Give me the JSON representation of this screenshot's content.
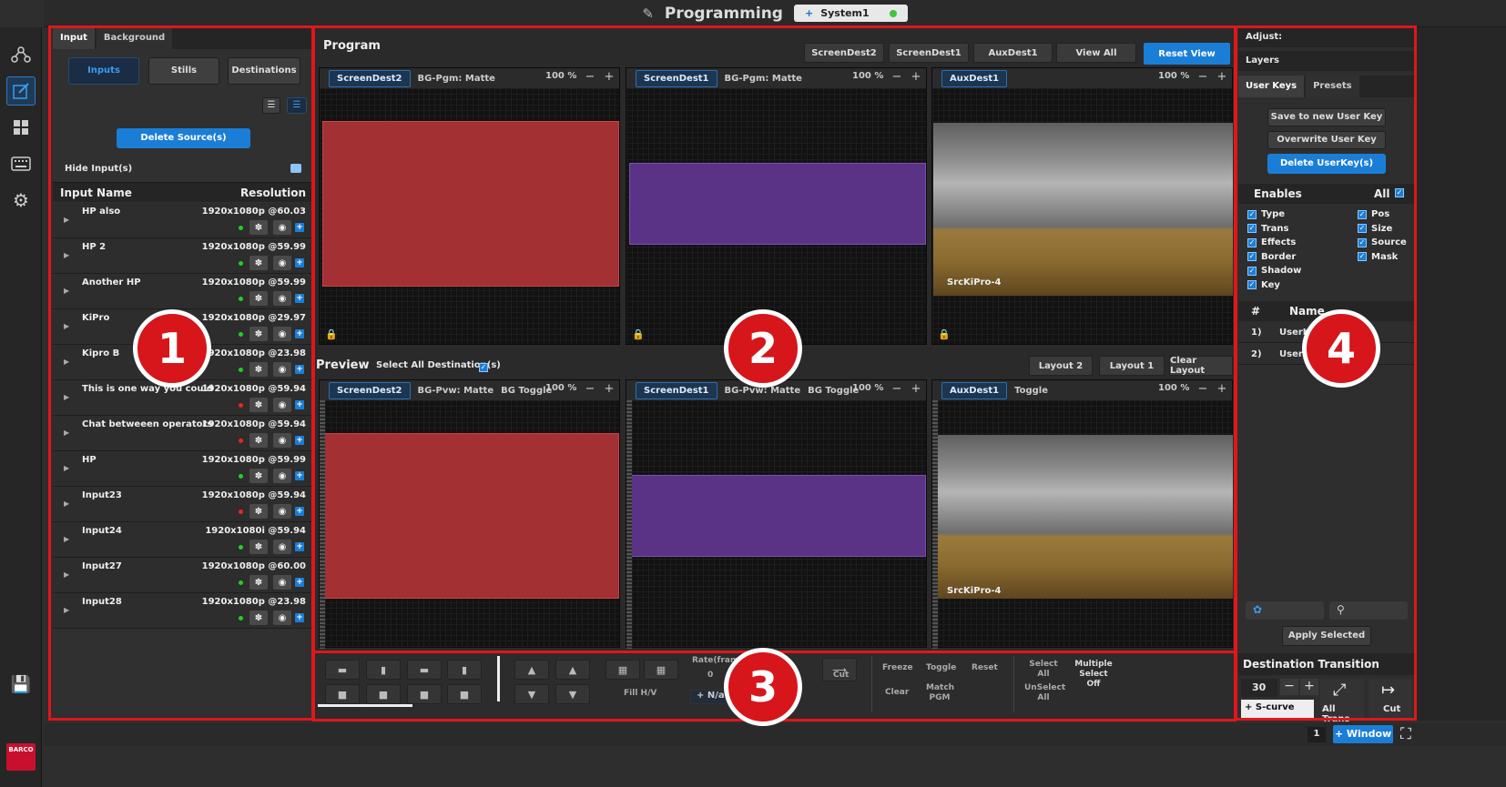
{
  "title": {
    "text": "Programming",
    "system_label": "System1"
  },
  "nav": {
    "icons": [
      "routing-icon",
      "programming-icon",
      "layout-icon",
      "keyboard-icon",
      "settings-icon"
    ],
    "save": "save-icon",
    "logo": "BARCO"
  },
  "left": {
    "tabs": [
      "Input",
      "Background"
    ],
    "subtabs": [
      "Inputs",
      "Stills",
      "Destinations"
    ],
    "delete_btn": "Delete Source(s)",
    "hide_label": "Hide Input(s)",
    "col_name": "Input Name",
    "col_res": "Resolution",
    "inputs": [
      {
        "name": "HP also",
        "res": "1920x1080p @60.03",
        "led": "#1fd11f"
      },
      {
        "name": "HP 2",
        "res": "1920x1080p @59.99",
        "led": "#1fd11f"
      },
      {
        "name": "Another HP",
        "res": "1920x1080p @59.99",
        "led": "#1fd11f"
      },
      {
        "name": "KiPro",
        "res": "1920x1080p @29.97",
        "led": "#1fd11f"
      },
      {
        "name": "Kipro B",
        "res": "1920x1080p @23.98",
        "led": "#1fd11f"
      },
      {
        "name": "This is one way you could",
        "res": "1920x1080p @59.94",
        "led": "#e22"
      },
      {
        "name": "Chat betweeen operators",
        "res": "1920x1080p @59.94",
        "led": "#e22"
      },
      {
        "name": "HP",
        "res": "1920x1080p @59.99",
        "led": "#1fd11f"
      },
      {
        "name": "Input23",
        "res": "1920x1080p @59.94",
        "led": "#e22"
      },
      {
        "name": "Input24",
        "res": "1920x1080i @59.94",
        "led": "#1fd11f"
      },
      {
        "name": "Input27",
        "res": "1920x1080p @60.00",
        "led": "#1fd11f"
      },
      {
        "name": "Input28",
        "res": "1920x1080p @23.98",
        "led": "#1fd11f"
      }
    ]
  },
  "center": {
    "program_label": "Program",
    "preview_label": "Preview",
    "select_all": "Select All Destination(s)",
    "top_buttons": [
      "ScreenDest2",
      "ScreenDest1",
      "AuxDest1",
      "View All",
      "Reset View"
    ],
    "layout_buttons": [
      "Layout 2",
      "Layout 1",
      "Clear Layout"
    ],
    "pgm": [
      {
        "dest": "ScreenDest2",
        "label": "BG-Pgm: Matte",
        "extra": "",
        "pct": "100 %",
        "color": "#a33033"
      },
      {
        "dest": "ScreenDest1",
        "label": "BG-Pgm: Matte",
        "extra": "",
        "pct": "100 %",
        "color": "#5a3386"
      },
      {
        "dest": "AuxDest1",
        "label": "",
        "extra": "",
        "pct": "100 %",
        "src": "SrcKiPro-4"
      }
    ],
    "pvw": [
      {
        "dest": "ScreenDest2",
        "label": "BG-Pvw: Matte",
        "extra": "BG Toggle",
        "pct": "100 %"
      },
      {
        "dest": "ScreenDest1",
        "label": "BG-Pvw: Matte",
        "extra": "BG Toggle",
        "pct": "100 %"
      },
      {
        "dest": "AuxDest1",
        "label": "Toggle",
        "extra": "",
        "pct": "100 %",
        "src": "SrcKiPro-4"
      }
    ]
  },
  "bottom": {
    "fill": "Fill H/V",
    "rate_label": "Rate(fram",
    "rate_value": "0",
    "na": "+ N/a",
    "cut": "Cut",
    "freeze": "Freeze",
    "toggle": "Toggle",
    "reset": "Reset",
    "clear": "Clear",
    "match_pgm": "Match PGM",
    "select_all": "Select All",
    "unselect_all": "UnSelect All",
    "multiple": "Multiple Select Off"
  },
  "right": {
    "adjust": "Adjust:",
    "layers": "Layers",
    "tabs": [
      "User Keys",
      "Presets"
    ],
    "save_key": "Save to new User Key",
    "overwrite_key": "Overwrite User Key",
    "delete_key": "Delete UserKey(s)",
    "enables": "Enables",
    "all": "All",
    "left_checks": [
      "Type",
      "Trans",
      "Effects",
      "Border",
      "Shadow",
      "Key"
    ],
    "right_checks": [
      "Pos",
      "Size",
      "Source",
      "Mask"
    ],
    "col_num": "#",
    "col_name": "Name",
    "keys": [
      {
        "num": "1)",
        "name": "UserK"
      },
      {
        "num": "2)",
        "name": "User"
      }
    ],
    "apply": "Apply Selected",
    "dest_trans": "Destination Transition",
    "trans_value": "30",
    "scurve": "+ S-curve",
    "all_trans": "All Trans",
    "cut": "Cut"
  },
  "footer": {
    "count": "1",
    "window_btn": "+ Window"
  },
  "badges": [
    "1",
    "2",
    "3",
    "4"
  ]
}
